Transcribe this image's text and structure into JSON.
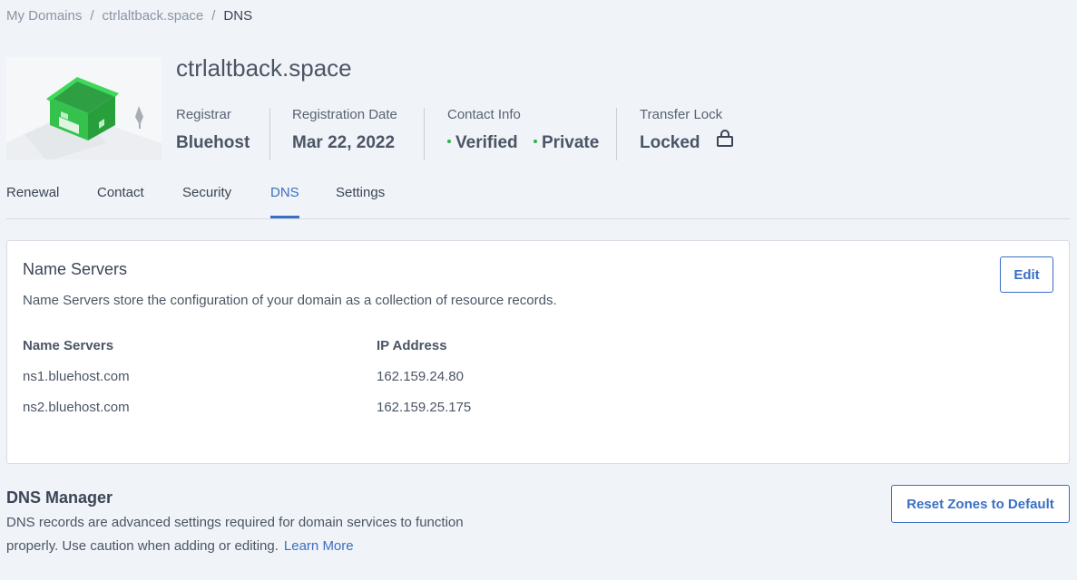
{
  "breadcrumb": {
    "items": [
      "My Domains",
      "ctrlaltback.space"
    ],
    "current": "DNS",
    "separator": "/"
  },
  "domain": {
    "name": "ctrlaltback.space",
    "image_icon": "house-illustration"
  },
  "meta": {
    "registrar": {
      "label": "Registrar",
      "value": "Bluehost"
    },
    "registration_date": {
      "label": "Registration Date",
      "value": "Mar 22, 2022"
    },
    "contact_info": {
      "label": "Contact Info",
      "verified": "Verified",
      "private": "Private"
    },
    "transfer_lock": {
      "label": "Transfer Lock",
      "value": "Locked",
      "icon": "lock-icon"
    }
  },
  "tabs": [
    {
      "label": "Renewal"
    },
    {
      "label": "Contact"
    },
    {
      "label": "Security"
    },
    {
      "label": "DNS",
      "active": true
    },
    {
      "label": "Settings"
    }
  ],
  "name_servers": {
    "title": "Name Servers",
    "description": "Name Servers store the configuration of your domain as a collection of resource records.",
    "edit_label": "Edit",
    "columns": [
      "Name Servers",
      "IP Address"
    ],
    "rows": [
      {
        "server": "ns1.bluehost.com",
        "ip": "162.159.24.80"
      },
      {
        "server": "ns2.bluehost.com",
        "ip": "162.159.25.175"
      }
    ]
  },
  "dns_manager": {
    "title": "DNS Manager",
    "description": "DNS records are advanced settings required for domain services to function properly. Use caution when adding or editing.",
    "learn_more": "Learn More",
    "reset_label": "Reset Zones to Default"
  },
  "colors": {
    "accent": "#3a6fc4",
    "status_green": "#2bb34a",
    "background": "#f0f3f7",
    "text": "#3b4556"
  }
}
